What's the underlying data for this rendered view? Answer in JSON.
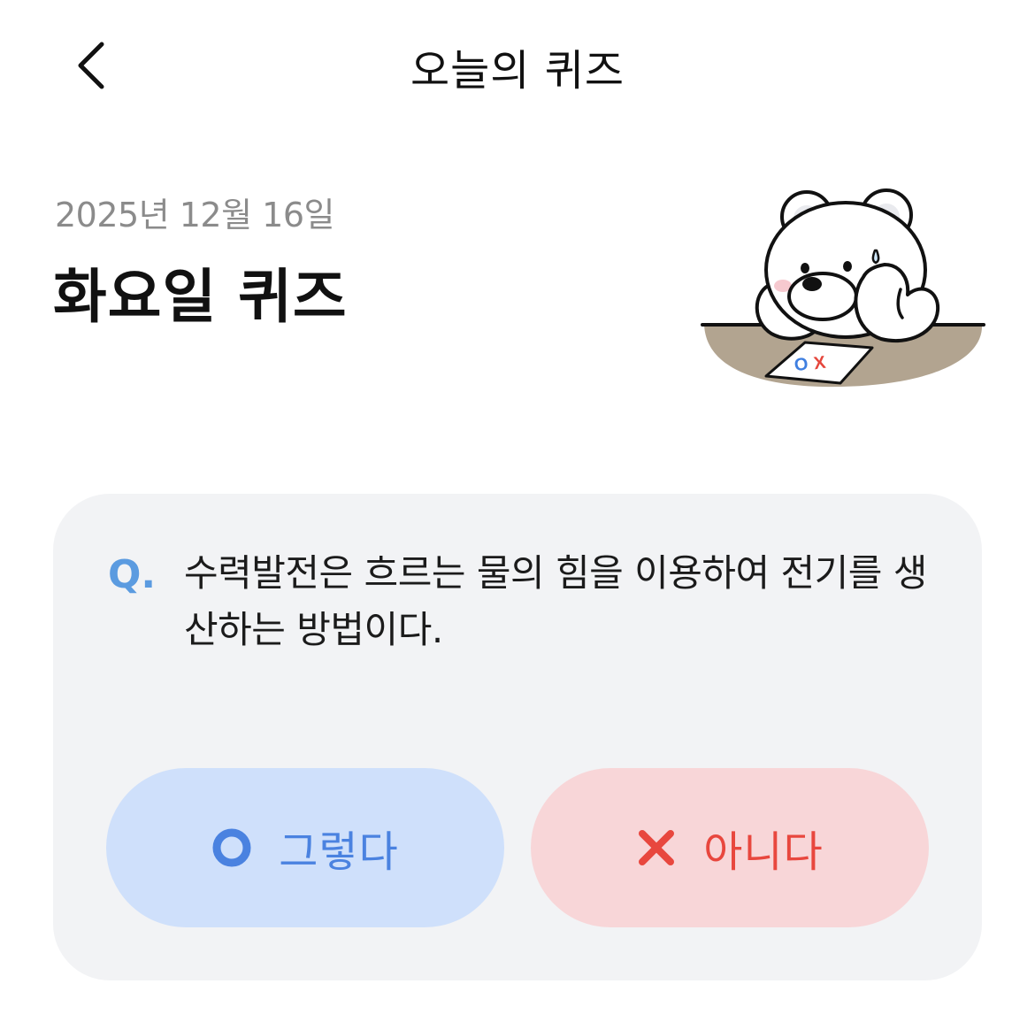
{
  "header": {
    "title": "오늘의 퀴즈",
    "back_icon": "chevron-left-icon"
  },
  "quiz": {
    "date": "2025년 12월 16일",
    "title": "화요일 퀴즈",
    "q_mark": "Q.",
    "question": "수력발전은 흐르는 물의 힘을 이용하여 전기를 생산하는 방법이다."
  },
  "mascot": {
    "icon": "bear-mascot-illustration",
    "sheet_o": "O",
    "sheet_x": "X"
  },
  "answers": {
    "yes_label": "그렇다",
    "yes_icon": "circle-o-icon",
    "no_label": "아니다",
    "no_icon": "x-icon"
  },
  "colors": {
    "yes_bg": "#cfe0fb",
    "yes_fg": "#4a82e0",
    "no_bg": "#f8d6d8",
    "no_fg": "#e8473e",
    "card_bg": "#f2f3f5",
    "q_mark": "#5b9be0"
  }
}
